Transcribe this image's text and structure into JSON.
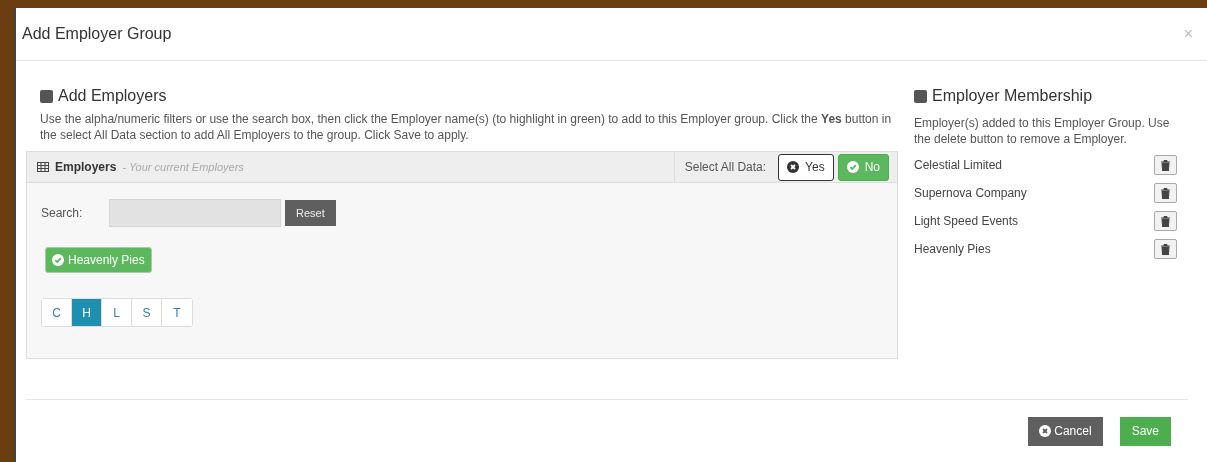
{
  "dialog": {
    "title": "Add Employer Group",
    "close": "×"
  },
  "add_section": {
    "heading": "Add Employers",
    "description": "Use the alpha/numeric filters or use the search box, then click the Employer name(s) (to highlight in green) to add to this Employer group. Click the **Yes** button in the select All Data section to add All Employers to the group. Click Save to apply."
  },
  "panel": {
    "title": "Employers",
    "subtitle": "- Your current Employers",
    "select_all_label": "Select All Data:",
    "select_all_options": [
      {
        "label": "Yes",
        "selected": false
      },
      {
        "label": "No",
        "selected": true
      }
    ],
    "search_label": "Search:",
    "reset": "Reset",
    "chips": [
      {
        "label": "Heavenly Pies",
        "selected": true
      }
    ],
    "letters": [
      {
        "label": "C",
        "selected": false
      },
      {
        "label": "H",
        "selected": true
      },
      {
        "label": "L",
        "selected": false
      },
      {
        "label": "S",
        "selected": false
      },
      {
        "label": "T",
        "selected": false
      }
    ]
  },
  "membership": {
    "heading": "Employer Membership",
    "description": "Employer(s) added to this Employer Group. Use the delete button to remove a Employer.",
    "members": [
      "Celestial Limited",
      "Supernova Company",
      "Light Speed Events",
      "Heavenly Pies"
    ]
  },
  "footer": {
    "buttons": [
      {
        "label": "Cancel",
        "kind": "cancel"
      },
      {
        "label": "Save",
        "kind": "save"
      }
    ]
  }
}
